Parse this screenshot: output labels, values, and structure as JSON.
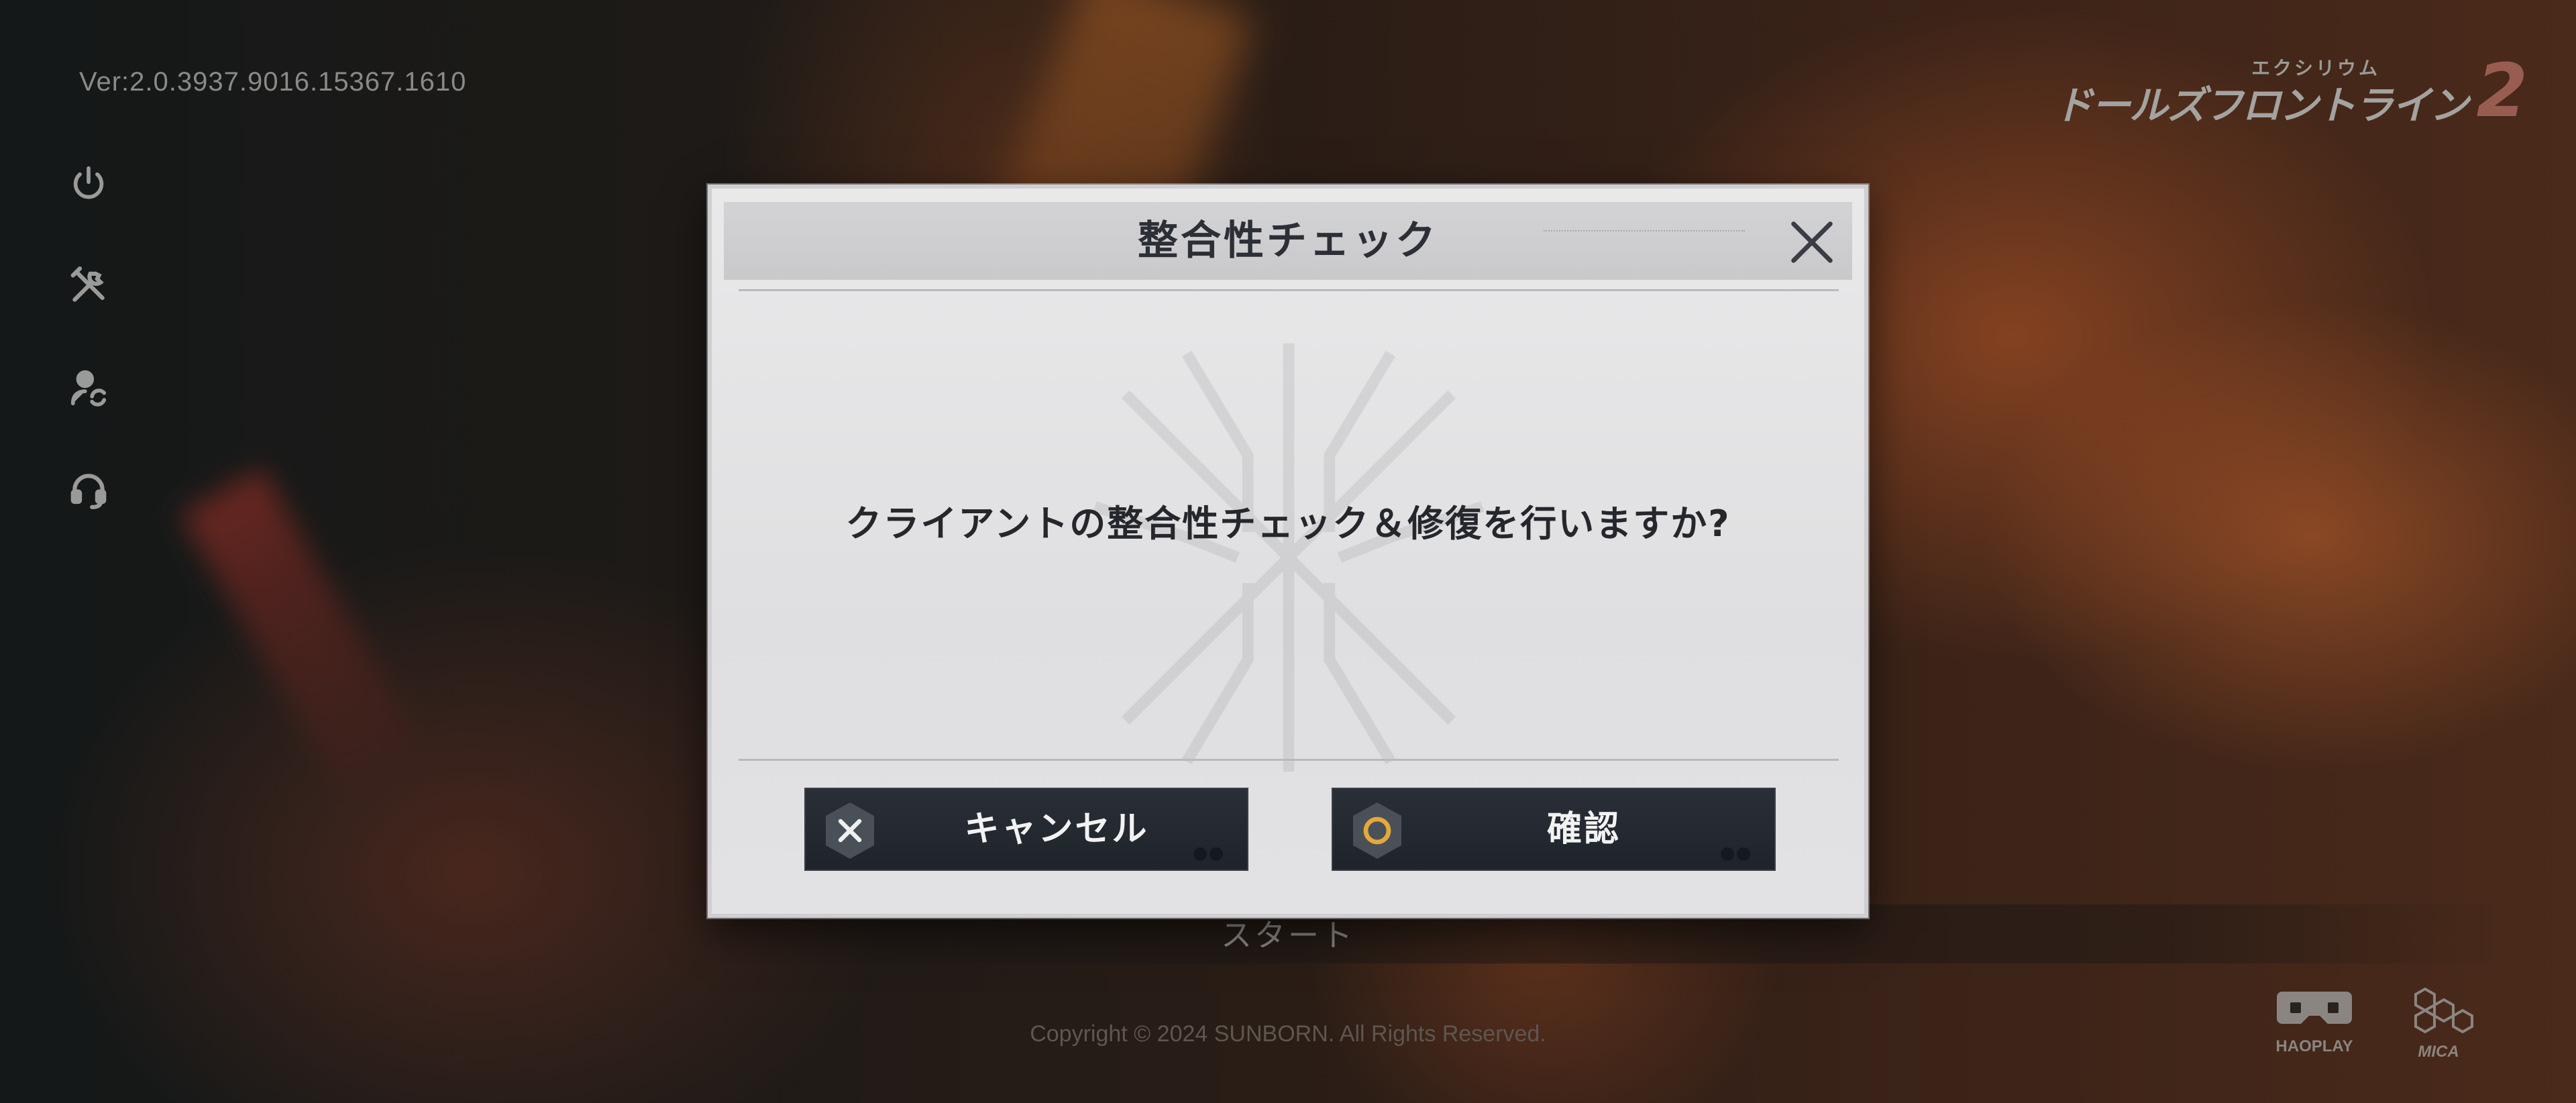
{
  "version": "Ver:2.0.3937.9016.15367.1610",
  "sidebar": {
    "items": [
      {
        "icon": "power-icon"
      },
      {
        "icon": "tools-icon"
      },
      {
        "icon": "account-switch-icon"
      },
      {
        "icon": "headset-icon"
      }
    ]
  },
  "logo": {
    "subtitle": "エクシリウム",
    "title": "ドールズフロントライン",
    "number": "2"
  },
  "dialog": {
    "title": "整合性チェック",
    "message": "クライアントの整合性チェック＆修復を行いますか?",
    "cancel_label": "キャンセル",
    "confirm_label": "確認"
  },
  "start_label": "スタート",
  "copyright": "Copyright © 2024 SUNBORN. All Rights Reserved.",
  "brands": {
    "haoplay": "HAOPLAY",
    "mica": "MICA"
  },
  "colors": {
    "dialog_bg": "#e4e4e6",
    "button_bg": "#232830",
    "confirm_ring": "#e3a93a",
    "text_dark": "#25272c"
  }
}
